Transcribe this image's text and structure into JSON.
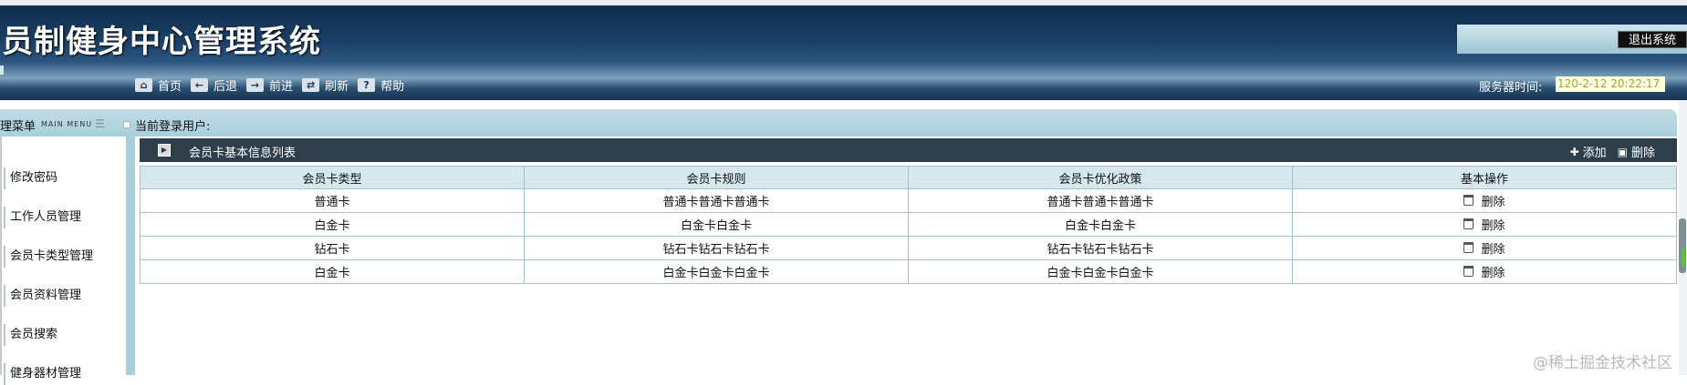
{
  "header": {
    "app_title": "员制健身中心管理系统",
    "logout_label": "退出系统",
    "toolbar": [
      {
        "icon": "home-icon",
        "glyph": "⌂",
        "label": "首页"
      },
      {
        "icon": "back-icon",
        "glyph": "←",
        "label": "后退"
      },
      {
        "icon": "forward-icon",
        "glyph": "→",
        "label": "前进"
      },
      {
        "icon": "refresh-icon",
        "glyph": "⇄",
        "label": "刷新"
      },
      {
        "icon": "help-icon",
        "glyph": "?",
        "label": "帮助"
      }
    ],
    "server_time_label": "服务器时间:",
    "server_time_value": "120-2-12 20:22:17"
  },
  "subbar": {
    "menu_title": "理菜单",
    "menu_title_en": "MAIN MENU",
    "current_user_label": "当前登录用户:"
  },
  "sidebar": {
    "items": [
      {
        "label": "修改密码"
      },
      {
        "label": "工作人员管理"
      },
      {
        "label": "会员卡类型管理"
      },
      {
        "label": "会员资料管理"
      },
      {
        "label": "会员搜索"
      },
      {
        "label": "健身器材管理"
      }
    ]
  },
  "panel": {
    "title": "会员卡基本信息列表",
    "add_label": "添加",
    "delete_label": "删除"
  },
  "table": {
    "columns": [
      "会员卡类型",
      "会员卡规则",
      "会员卡优化政策",
      "基本操作"
    ],
    "rows": [
      [
        "普通卡",
        "普通卡普通卡普通卡",
        "普通卡普通卡普通卡",
        "删除"
      ],
      [
        "白金卡",
        "白金卡白金卡",
        "白金卡白金卡",
        "删除"
      ],
      [
        "钻石卡",
        "钻石卡钻石卡钻石卡",
        "钻石卡钻石卡钻石卡",
        "删除"
      ],
      [
        "白金卡",
        "白金卡白金卡白金卡",
        "白金卡白金卡白金卡",
        "删除"
      ]
    ]
  },
  "watermark": "@稀土掘金技术社区"
}
